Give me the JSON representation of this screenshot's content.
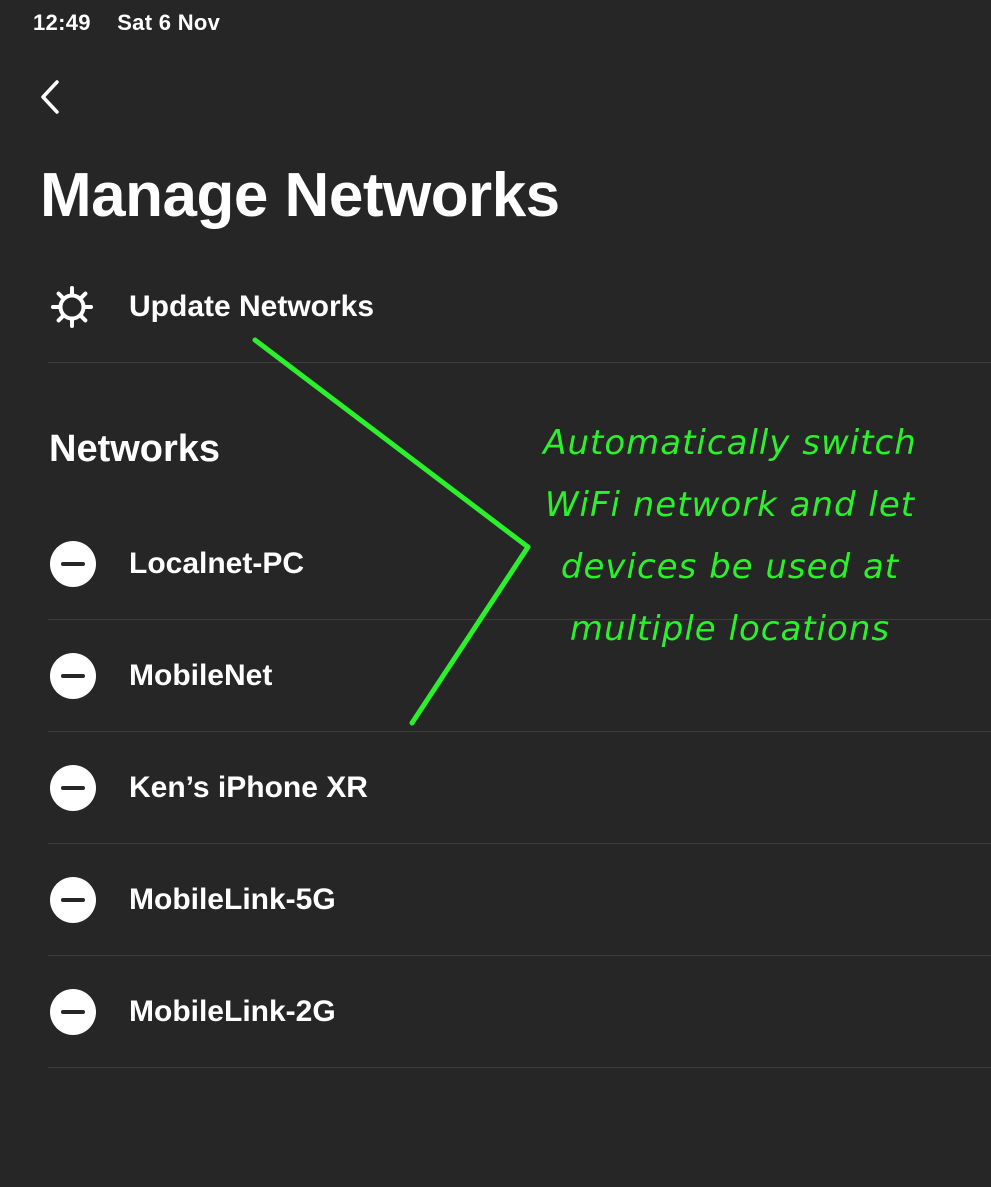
{
  "status_bar": {
    "time": "12:49",
    "date": "Sat 6 Nov"
  },
  "nav": {
    "back_icon": "chevron-left-icon"
  },
  "page": {
    "title": "Manage Networks"
  },
  "actions": {
    "update_networks": {
      "icon": "gear-icon",
      "label": "Update Networks"
    }
  },
  "networks_section": {
    "heading": "Networks",
    "items": [
      {
        "name": "Localnet-PC"
      },
      {
        "name": "MobileNet"
      },
      {
        "name": "Ken’s iPhone XR"
      },
      {
        "name": "MobileLink-5G"
      },
      {
        "name": "MobileLink-2G"
      }
    ]
  },
  "annotation": {
    "text": "Automatically switch WiFi network and let devices be used at multiple locations",
    "color": "#2cf02c"
  },
  "colors": {
    "background": "#262626",
    "text": "#ffffff",
    "divider": "#3d3d3d",
    "annotation": "#2cf02c"
  }
}
